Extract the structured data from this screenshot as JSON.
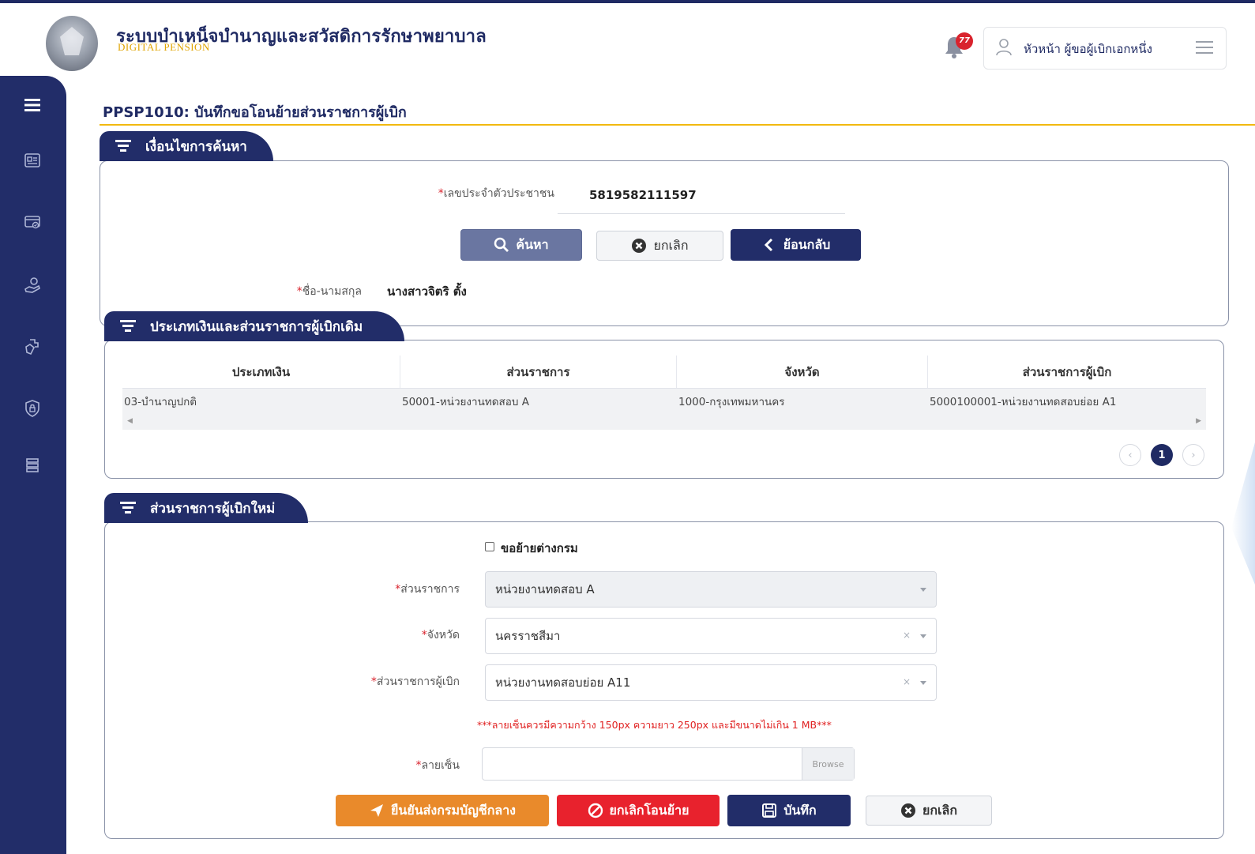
{
  "header": {
    "app_title": "ระบบบำเหน็จบำนาญและสวัสดิการรักษาพยาบาล",
    "app_subtitle": "DIGITAL PENSION",
    "notification_count": "77",
    "user_name": "หัวหน้า ผู้ขอผู้เบิกเอกหนึ่ง"
  },
  "sidebar": {
    "items": [
      "menu-icon",
      "id-card-icon",
      "payment-card-icon",
      "money-hand-icon",
      "medical-hand-icon",
      "lock-shield-icon",
      "database-icon"
    ]
  },
  "page": {
    "title": "PPSP1010: บันทึกขอโอนย้ายส่วนราชการผู้เบิก"
  },
  "search_section": {
    "tab_label": "เงื่อนไขการค้นหา",
    "id_label": "เลขประจำตัวประชาชน",
    "id_value": "5819582111597",
    "search_button": "ค้นหา",
    "cancel_button": "ยกเลิก",
    "back_button": "ย้อนกลับ",
    "name_label": "ชื่อ-นามสกุล",
    "name_value": "นางสาวจิตริ ตั้ง"
  },
  "old_section": {
    "tab_label": "ประเภทเงินและส่วนราชการผู้เบิกเดิม",
    "columns": [
      "ประเภทเงิน",
      "ส่วนราชการ",
      "จังหวัด",
      "ส่วนราชการผู้เบิก"
    ],
    "rows": [
      [
        "03-บำนาญปกติ",
        "50001-หน่วยงานทดสอบ A",
        "1000-กรุงเทพมหานคร",
        "5000100001-หน่วยงานทดสอบย่อย A1"
      ]
    ],
    "pagination": {
      "current": "1"
    }
  },
  "new_section": {
    "tab_label": "ส่วนราชการผู้เบิกใหม่",
    "checkbox_label": "ขอย้ายต่างกรม",
    "checkbox_checked": false,
    "agency_label": "ส่วนราชการ",
    "agency_value": "หน่วยงานทดสอบ A",
    "province_label": "จังหวัด",
    "province_value": "นครราชสีมา",
    "sub_agency_label": "ส่วนราชการผู้เบิก",
    "sub_agency_value": "หน่วยงานทดสอบย่อย A11",
    "signature_note": "***ลายเซ็นควรมีความกว้าง 150px ความยาว 250px และมีขนาดไม่เกิน 1 MB***",
    "signature_label": "ลายเซ็น",
    "browse_label": "Browse",
    "confirm_button": "ยืนยันส่งกรมบัญชีกลาง",
    "cancel_transfer_button": "ยกเลิกโอนย้าย",
    "save_button": "บันทึก",
    "cancel_button": "ยกเลิก"
  },
  "colors": {
    "navy": "#222d69",
    "accent_yellow": "#f2b90f",
    "orange": "#e98a2b",
    "red": "#e8222d"
  }
}
